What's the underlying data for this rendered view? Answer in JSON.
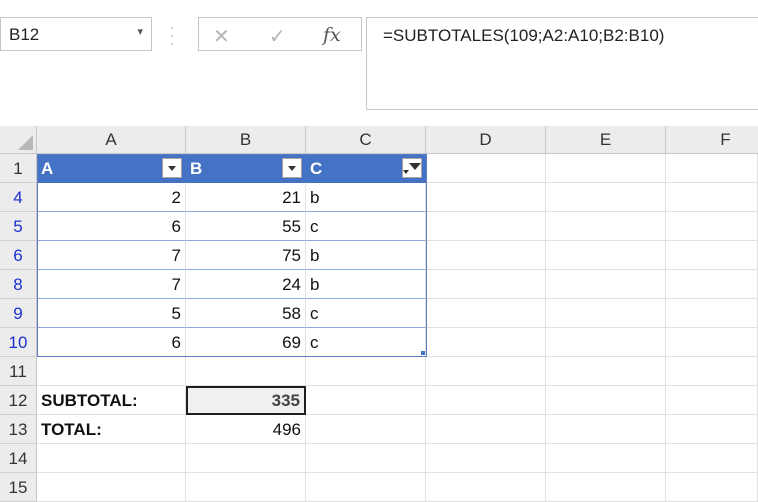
{
  "name_box": {
    "value": "B12"
  },
  "formula_bar": {
    "cancel_icon": "✕",
    "enter_icon": "✓",
    "fx_label": "fx",
    "formula": "=SUBTOTALES(109;A2:A10;B2:B10)"
  },
  "columns": [
    "A",
    "B",
    "C",
    "D",
    "E",
    "F"
  ],
  "rows": [
    {
      "num": "1",
      "filtered": false
    },
    {
      "num": "4",
      "filtered": true
    },
    {
      "num": "5",
      "filtered": true
    },
    {
      "num": "6",
      "filtered": true
    },
    {
      "num": "8",
      "filtered": true
    },
    {
      "num": "9",
      "filtered": true
    },
    {
      "num": "10",
      "filtered": true
    },
    {
      "num": "11",
      "filtered": false
    },
    {
      "num": "12",
      "filtered": false
    },
    {
      "num": "13",
      "filtered": false
    },
    {
      "num": "14",
      "filtered": false
    },
    {
      "num": "15",
      "filtered": false
    }
  ],
  "table": {
    "headers": [
      "A",
      "B",
      "C"
    ],
    "header_filter_active": [
      false,
      false,
      true
    ],
    "rows": [
      [
        "2",
        "21",
        "b"
      ],
      [
        "6",
        "55",
        "c"
      ],
      [
        "7",
        "75",
        "b"
      ],
      [
        "7",
        "24",
        "b"
      ],
      [
        "5",
        "58",
        "c"
      ],
      [
        "6",
        "69",
        "c"
      ]
    ]
  },
  "summary": {
    "subtotal_label": "SUBTOTAL:",
    "subtotal_value": "335",
    "total_label": "TOTAL:",
    "total_value": "496"
  },
  "colors": {
    "table_header_bg": "#4472c4",
    "filtered_row_number": "#1a2fcf"
  }
}
